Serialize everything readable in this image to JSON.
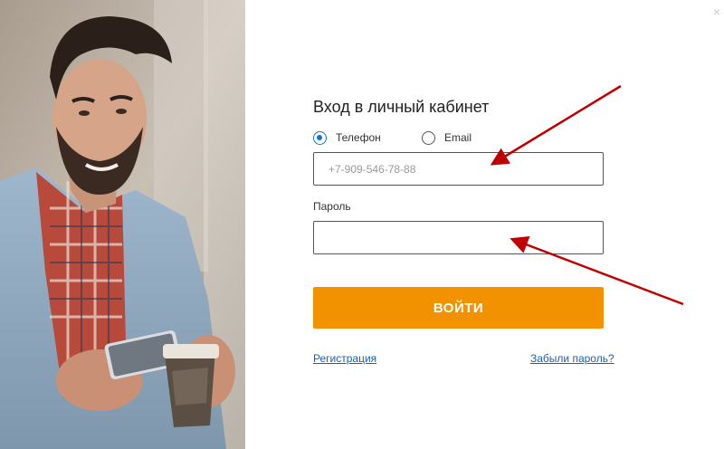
{
  "dialog": {
    "close_glyph": "×",
    "title": "Вход в личный кабинет"
  },
  "login_type": {
    "options": [
      {
        "label": "Телефон",
        "selected": true
      },
      {
        "label": "Email",
        "selected": false
      }
    ]
  },
  "phone_field": {
    "placeholder": "+7-909-546-78-88",
    "value": ""
  },
  "password_field": {
    "label": "Пароль",
    "value": ""
  },
  "submit": {
    "label": "ВОЙТИ"
  },
  "links": {
    "register": "Регистрация",
    "forgot_password": "Забыли пароль?"
  },
  "colors": {
    "accent_orange": "#f39200",
    "link_blue": "#1f5fa8",
    "radio_selected": "#1a73c8",
    "annotation_arrow": "#c00000"
  },
  "icons": {
    "close": "close-icon",
    "annotation": "arrow-annotation"
  }
}
